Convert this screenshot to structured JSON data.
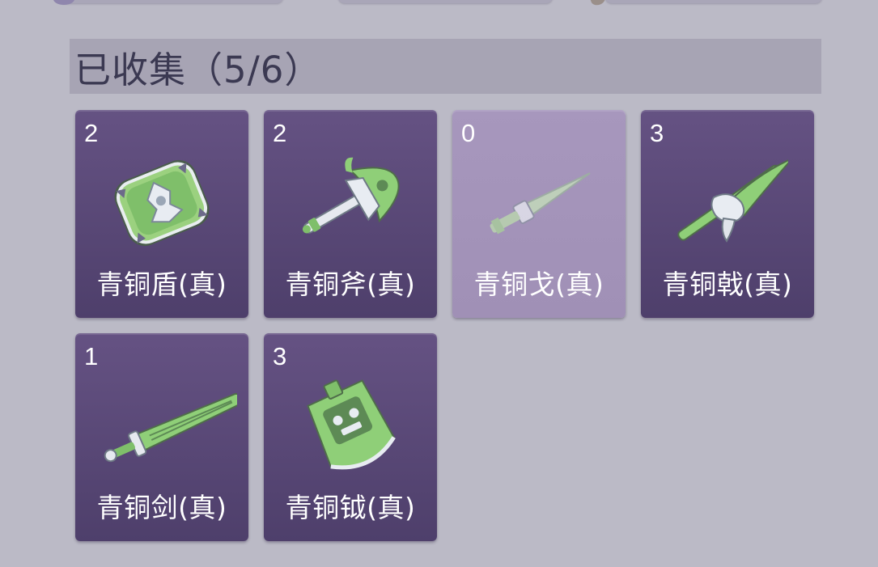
{
  "section": {
    "title": "已收集（5/6）"
  },
  "items": [
    {
      "count": "2",
      "name": "青铜盾(真)",
      "icon": "bronze-shield",
      "dimmed": false
    },
    {
      "count": "2",
      "name": "青铜斧(真)",
      "icon": "bronze-axe",
      "dimmed": false
    },
    {
      "count": "0",
      "name": "青铜戈(真)",
      "icon": "bronze-dagger-axe",
      "dimmed": true
    },
    {
      "count": "3",
      "name": "青铜戟(真)",
      "icon": "bronze-halberd",
      "dimmed": false
    },
    {
      "count": "1",
      "name": "青铜剑(真)",
      "icon": "bronze-sword",
      "dimmed": false
    },
    {
      "count": "3",
      "name": "青铜钺(真)",
      "icon": "bronze-battle-axe",
      "dimmed": false
    }
  ],
  "colors": {
    "background": "#bbbac6",
    "header": "#a7a4b4",
    "card": "#5a4a78",
    "card_dim": "#a797bd",
    "jade": "#8fc77a"
  }
}
